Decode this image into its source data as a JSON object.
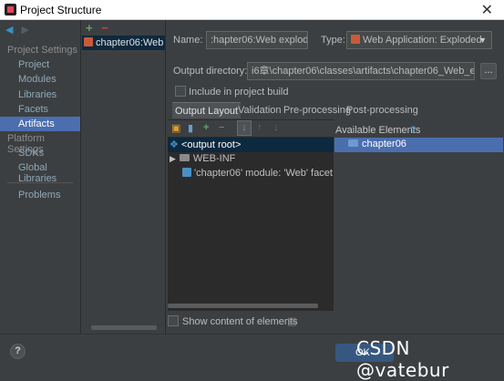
{
  "window": {
    "title": "Project Structure",
    "close_glyph": "✕"
  },
  "nav": {
    "back_glyph": "◀",
    "forward_glyph": "▶",
    "project_settings_header": "Project Settings",
    "project_settings_items": [
      "Project",
      "Modules",
      "Libraries",
      "Facets",
      "Artifacts"
    ],
    "selected": "Artifacts",
    "platform_settings_header": "Platform Settings",
    "platform_settings_items": [
      "SDKs",
      "Global Libraries"
    ],
    "problems": "Problems"
  },
  "artifacts": {
    "add_glyph": "+",
    "remove_glyph": "−",
    "items": [
      "chapter06:Web exploded"
    ]
  },
  "form": {
    "name_label": "Name:",
    "name_value": ":hapter06:Web exploded",
    "type_label": "Type:",
    "type_value": "Web Application: Exploded",
    "output_dir_label": "Output directory:",
    "output_dir_value": "i6章\\chapter06\\classes\\artifacts\\chapter06_Web_exploded",
    "browse_glyph": "...",
    "include_build_label": "Include in project build",
    "include_build_checked": false
  },
  "tabs": [
    "Output Layout",
    "Validation",
    "Pre-processing",
    "Post-processing"
  ],
  "active_tab": "Output Layout",
  "layout_tree": {
    "toolbar_icons": [
      "folder-add-icon",
      "archive-icon",
      "add-icon",
      "remove-icon",
      "sort-icon",
      "move-up-icon",
      "move-down-icon"
    ],
    "rows": [
      "<output root>",
      "WEB-INF",
      "'chapter06' module: 'Web' facet resou"
    ]
  },
  "available": {
    "header": "Available Elements",
    "help_glyph": "?",
    "items": [
      "chapter06"
    ]
  },
  "show_content_label": "Show content of elements",
  "footer": {
    "help_glyph": "?",
    "ok_label": "OK"
  },
  "watermark": "CSDN @vatebur",
  "colors": {
    "selection": "#4b6eaf",
    "inactive_selection": "#0d293e",
    "background": "#3c3f41",
    "tree_bg": "#2b2b2b"
  }
}
